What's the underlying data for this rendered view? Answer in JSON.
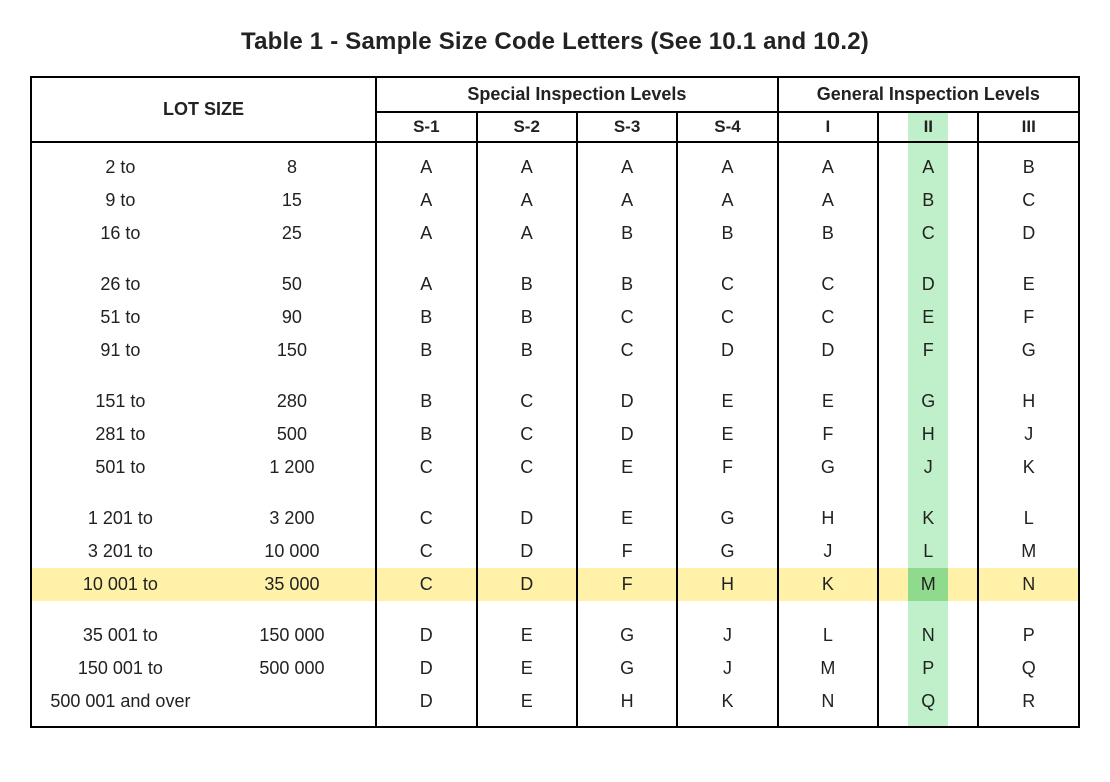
{
  "title": "Table 1 - Sample Size Code Letters (See 10.1 and 10.2)",
  "headers": {
    "lot_size": "LOT SIZE",
    "special": "Special Inspection Levels",
    "general": "General Inspection Levels",
    "cols": {
      "s1": "S-1",
      "s2": "S-2",
      "s3": "S-3",
      "s4": "S-4",
      "g1": "I",
      "g2": "II",
      "g3": "III"
    }
  },
  "highlight": {
    "row_index": 11,
    "col_key": "g2"
  },
  "rows": [
    {
      "from": "2 to",
      "to": "8",
      "s1": "A",
      "s2": "A",
      "s3": "A",
      "s4": "A",
      "g1": "A",
      "g2": "A",
      "g3": "B"
    },
    {
      "from": "9 to",
      "to": "15",
      "s1": "A",
      "s2": "A",
      "s3": "A",
      "s4": "A",
      "g1": "A",
      "g2": "B",
      "g3": "C"
    },
    {
      "from": "16 to",
      "to": "25",
      "s1": "A",
      "s2": "A",
      "s3": "B",
      "s4": "B",
      "g1": "B",
      "g2": "C",
      "g3": "D"
    },
    {
      "from": "26 to",
      "to": "50",
      "s1": "A",
      "s2": "B",
      "s3": "B",
      "s4": "C",
      "g1": "C",
      "g2": "D",
      "g3": "E"
    },
    {
      "from": "51 to",
      "to": "90",
      "s1": "B",
      "s2": "B",
      "s3": "C",
      "s4": "C",
      "g1": "C",
      "g2": "E",
      "g3": "F"
    },
    {
      "from": "91 to",
      "to": "150",
      "s1": "B",
      "s2": "B",
      "s3": "C",
      "s4": "D",
      "g1": "D",
      "g2": "F",
      "g3": "G"
    },
    {
      "from": "151 to",
      "to": "280",
      "s1": "B",
      "s2": "C",
      "s3": "D",
      "s4": "E",
      "g1": "E",
      "g2": "G",
      "g3": "H"
    },
    {
      "from": "281 to",
      "to": "500",
      "s1": "B",
      "s2": "C",
      "s3": "D",
      "s4": "E",
      "g1": "F",
      "g2": "H",
      "g3": "J"
    },
    {
      "from": "501 to",
      "to": "1 200",
      "s1": "C",
      "s2": "C",
      "s3": "E",
      "s4": "F",
      "g1": "G",
      "g2": "J",
      "g3": "K"
    },
    {
      "from": "1 201 to",
      "to": "3 200",
      "s1": "C",
      "s2": "D",
      "s3": "E",
      "s4": "G",
      "g1": "H",
      "g2": "K",
      "g3": "L"
    },
    {
      "from": "3 201 to",
      "to": "10 000",
      "s1": "C",
      "s2": "D",
      "s3": "F",
      "s4": "G",
      "g1": "J",
      "g2": "L",
      "g3": "M"
    },
    {
      "from": "10 001 to",
      "to": "35 000",
      "s1": "C",
      "s2": "D",
      "s3": "F",
      "s4": "H",
      "g1": "K",
      "g2": "M",
      "g3": "N"
    },
    {
      "from": "35 001 to",
      "to": "150 000",
      "s1": "D",
      "s2": "E",
      "s3": "G",
      "s4": "J",
      "g1": "L",
      "g2": "N",
      "g3": "P"
    },
    {
      "from": "150 001 to",
      "to": "500 000",
      "s1": "D",
      "s2": "E",
      "s3": "G",
      "s4": "J",
      "g1": "M",
      "g2": "P",
      "g3": "Q"
    },
    {
      "from": "500 001 and over",
      "to": "",
      "s1": "D",
      "s2": "E",
      "s3": "H",
      "s4": "K",
      "g1": "N",
      "g2": "Q",
      "g3": "R"
    }
  ]
}
